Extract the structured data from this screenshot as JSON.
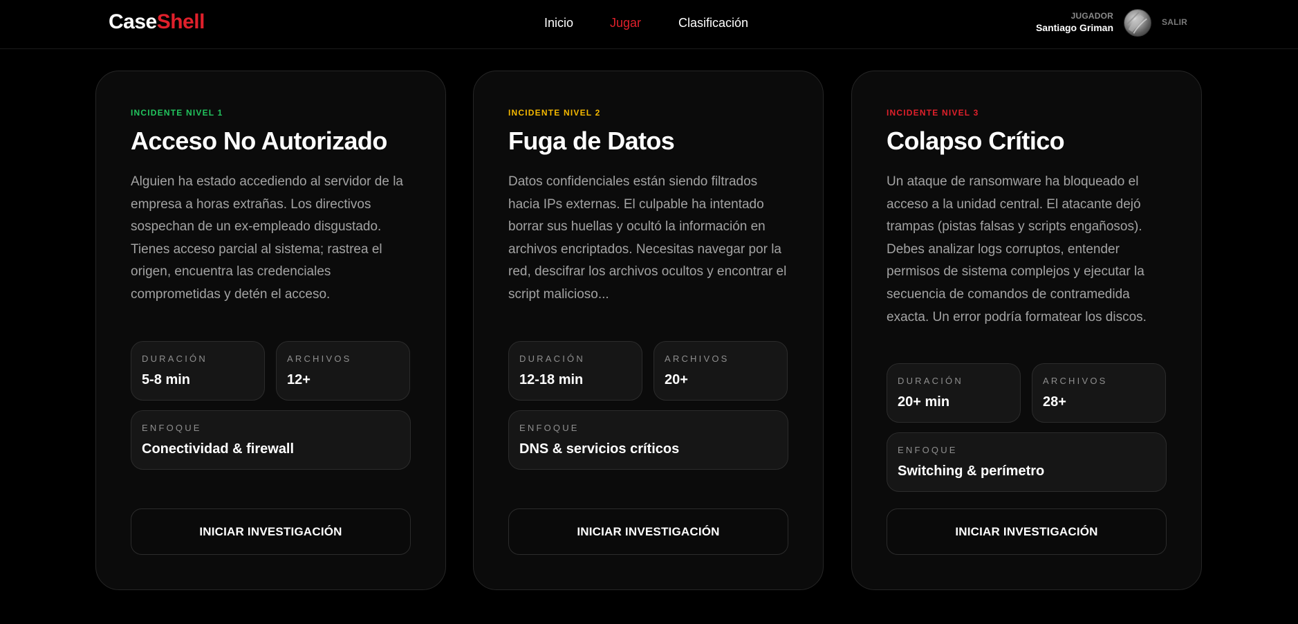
{
  "brand": {
    "part1": "Case",
    "part2": "Shell",
    "accent_color": "#e0202b"
  },
  "nav": {
    "items": [
      {
        "label": "Inicio",
        "active": false
      },
      {
        "label": "Jugar",
        "active": true
      },
      {
        "label": "Clasificación",
        "active": false
      }
    ]
  },
  "user": {
    "role": "JUGADOR",
    "name": "Santiago Griman",
    "avatar_icon": "avatar-photo",
    "logout_label": "SALIR"
  },
  "cards": [
    {
      "level": "INCIDENTE NIVEL 1",
      "level_color": "#22c55e",
      "title": "Acceso No Autorizado",
      "description": "Alguien ha estado accediendo al servidor de la empresa a horas extrañas. Los directivos sospechan de un ex-empleado disgustado. Tienes acceso parcial al sistema; rastrea el origen, encuentra las credenciales comprometidas y detén el acceso.",
      "duration_label": "DURACIÓN",
      "duration": "5-8 min",
      "files_label": "ARCHIVOS",
      "files": "12+",
      "focus_label": "ENFOQUE",
      "focus": "Conectividad & firewall",
      "button": "INICIAR INVESTIGACIÓN"
    },
    {
      "level": "INCIDENTE NIVEL 2",
      "level_color": "#f5b800",
      "title": "Fuga de Datos",
      "description": "Datos confidenciales están siendo filtrados hacia IPs externas. El culpable ha intentado borrar sus huellas y ocultó la información en archivos encriptados. Necesitas navegar por la red, descifrar los archivos ocultos y encontrar el script malicioso...",
      "duration_label": "DURACIÓN",
      "duration": "12-18 min",
      "files_label": "ARCHIVOS",
      "files": "20+",
      "focus_label": "ENFOQUE",
      "focus": "DNS & servicios críticos",
      "button": "INICIAR INVESTIGACIÓN"
    },
    {
      "level": "INCIDENTE NIVEL 3",
      "level_color": "#e0202b",
      "title": "Colapso Crítico",
      "description": "Un ataque de ransomware ha bloqueado el acceso a la unidad central. El atacante dejó trampas (pistas falsas y scripts engañosos). Debes analizar logs corruptos, entender permisos de sistema complejos y ejecutar la secuencia de comandos de contramedida exacta. Un error podría formatear los discos.",
      "duration_label": "DURACIÓN",
      "duration": "20+ min",
      "files_label": "ARCHIVOS",
      "files": "28+",
      "focus_label": "ENFOQUE",
      "focus": "Switching & perímetro",
      "button": "INICIAR INVESTIGACIÓN"
    }
  ]
}
